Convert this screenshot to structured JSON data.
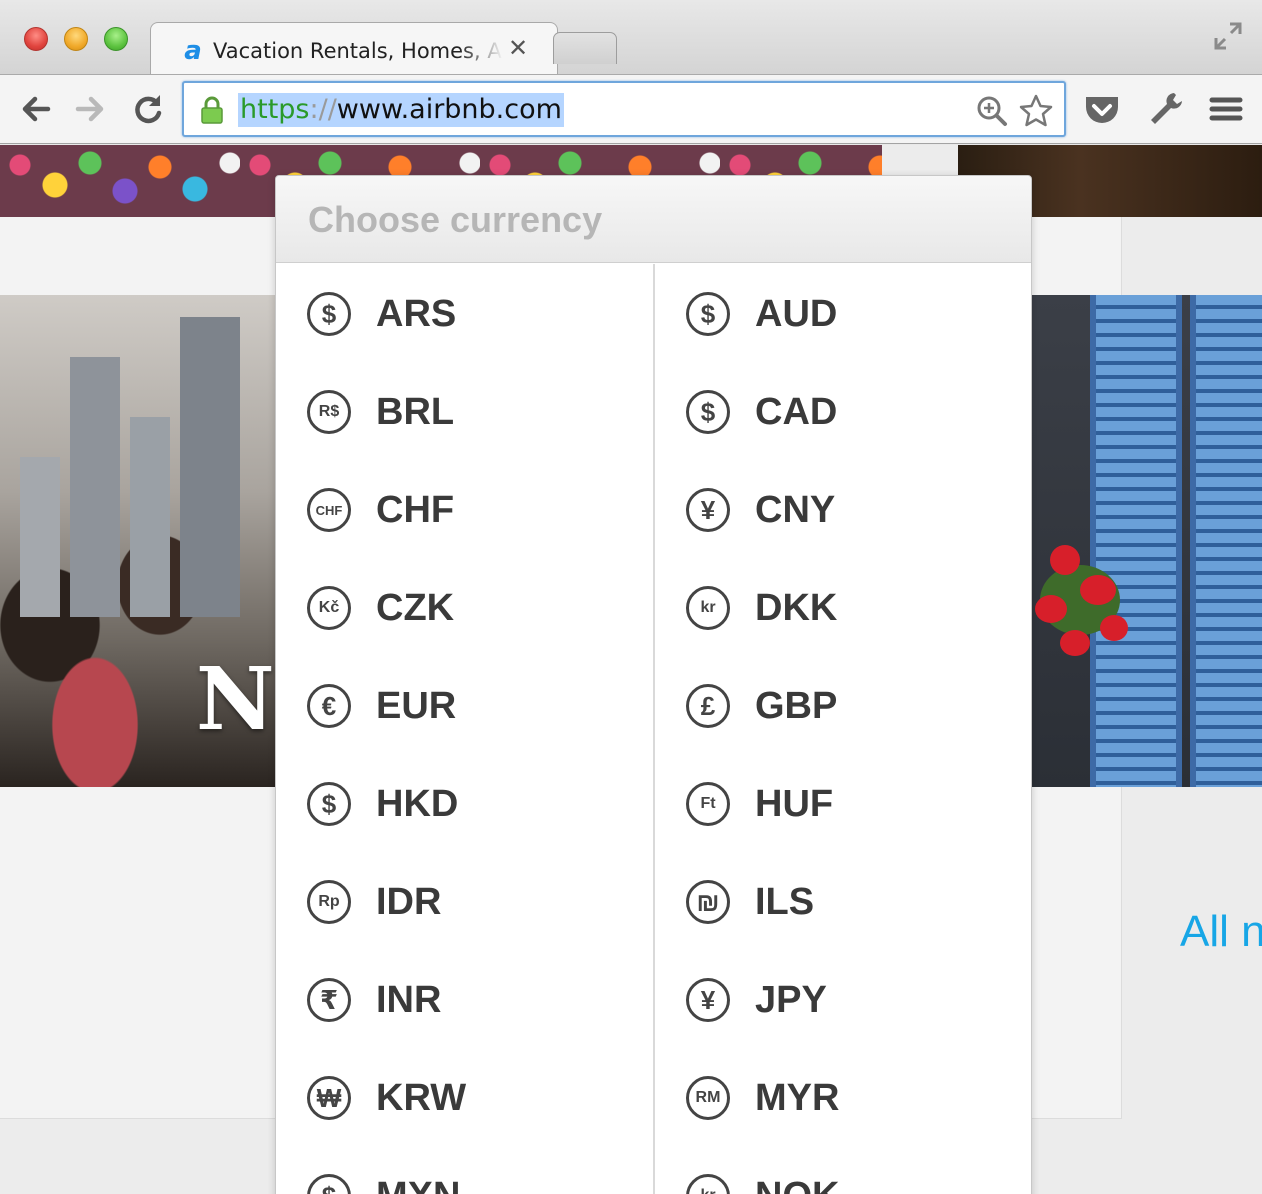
{
  "browser": {
    "tab_title": "Vacation Rentals, Homes, Apartments",
    "tab_close": "✕",
    "url_scheme": "https",
    "url_sep": "://",
    "url_host": "www.airbnb.com"
  },
  "page": {
    "photo_text": "N",
    "all_link": "All n"
  },
  "currency_menu": {
    "title": "Choose currency",
    "left": [
      {
        "code": "ARS",
        "symbol": "$"
      },
      {
        "code": "BRL",
        "symbol": "R$"
      },
      {
        "code": "CHF",
        "symbol": "CHF"
      },
      {
        "code": "CZK",
        "symbol": "Kč"
      },
      {
        "code": "EUR",
        "symbol": "€"
      },
      {
        "code": "HKD",
        "symbol": "$"
      },
      {
        "code": "IDR",
        "symbol": "Rp"
      },
      {
        "code": "INR",
        "symbol": "₹"
      },
      {
        "code": "KRW",
        "symbol": "₩"
      },
      {
        "code": "MXN",
        "symbol": "$"
      }
    ],
    "right": [
      {
        "code": "AUD",
        "symbol": "$"
      },
      {
        "code": "CAD",
        "symbol": "$"
      },
      {
        "code": "CNY",
        "symbol": "¥"
      },
      {
        "code": "DKK",
        "symbol": "kr"
      },
      {
        "code": "GBP",
        "symbol": "£"
      },
      {
        "code": "HUF",
        "symbol": "Ft"
      },
      {
        "code": "ILS",
        "symbol": "₪"
      },
      {
        "code": "JPY",
        "symbol": "¥"
      },
      {
        "code": "MYR",
        "symbol": "RM"
      },
      {
        "code": "NOK",
        "symbol": "kr"
      }
    ]
  }
}
